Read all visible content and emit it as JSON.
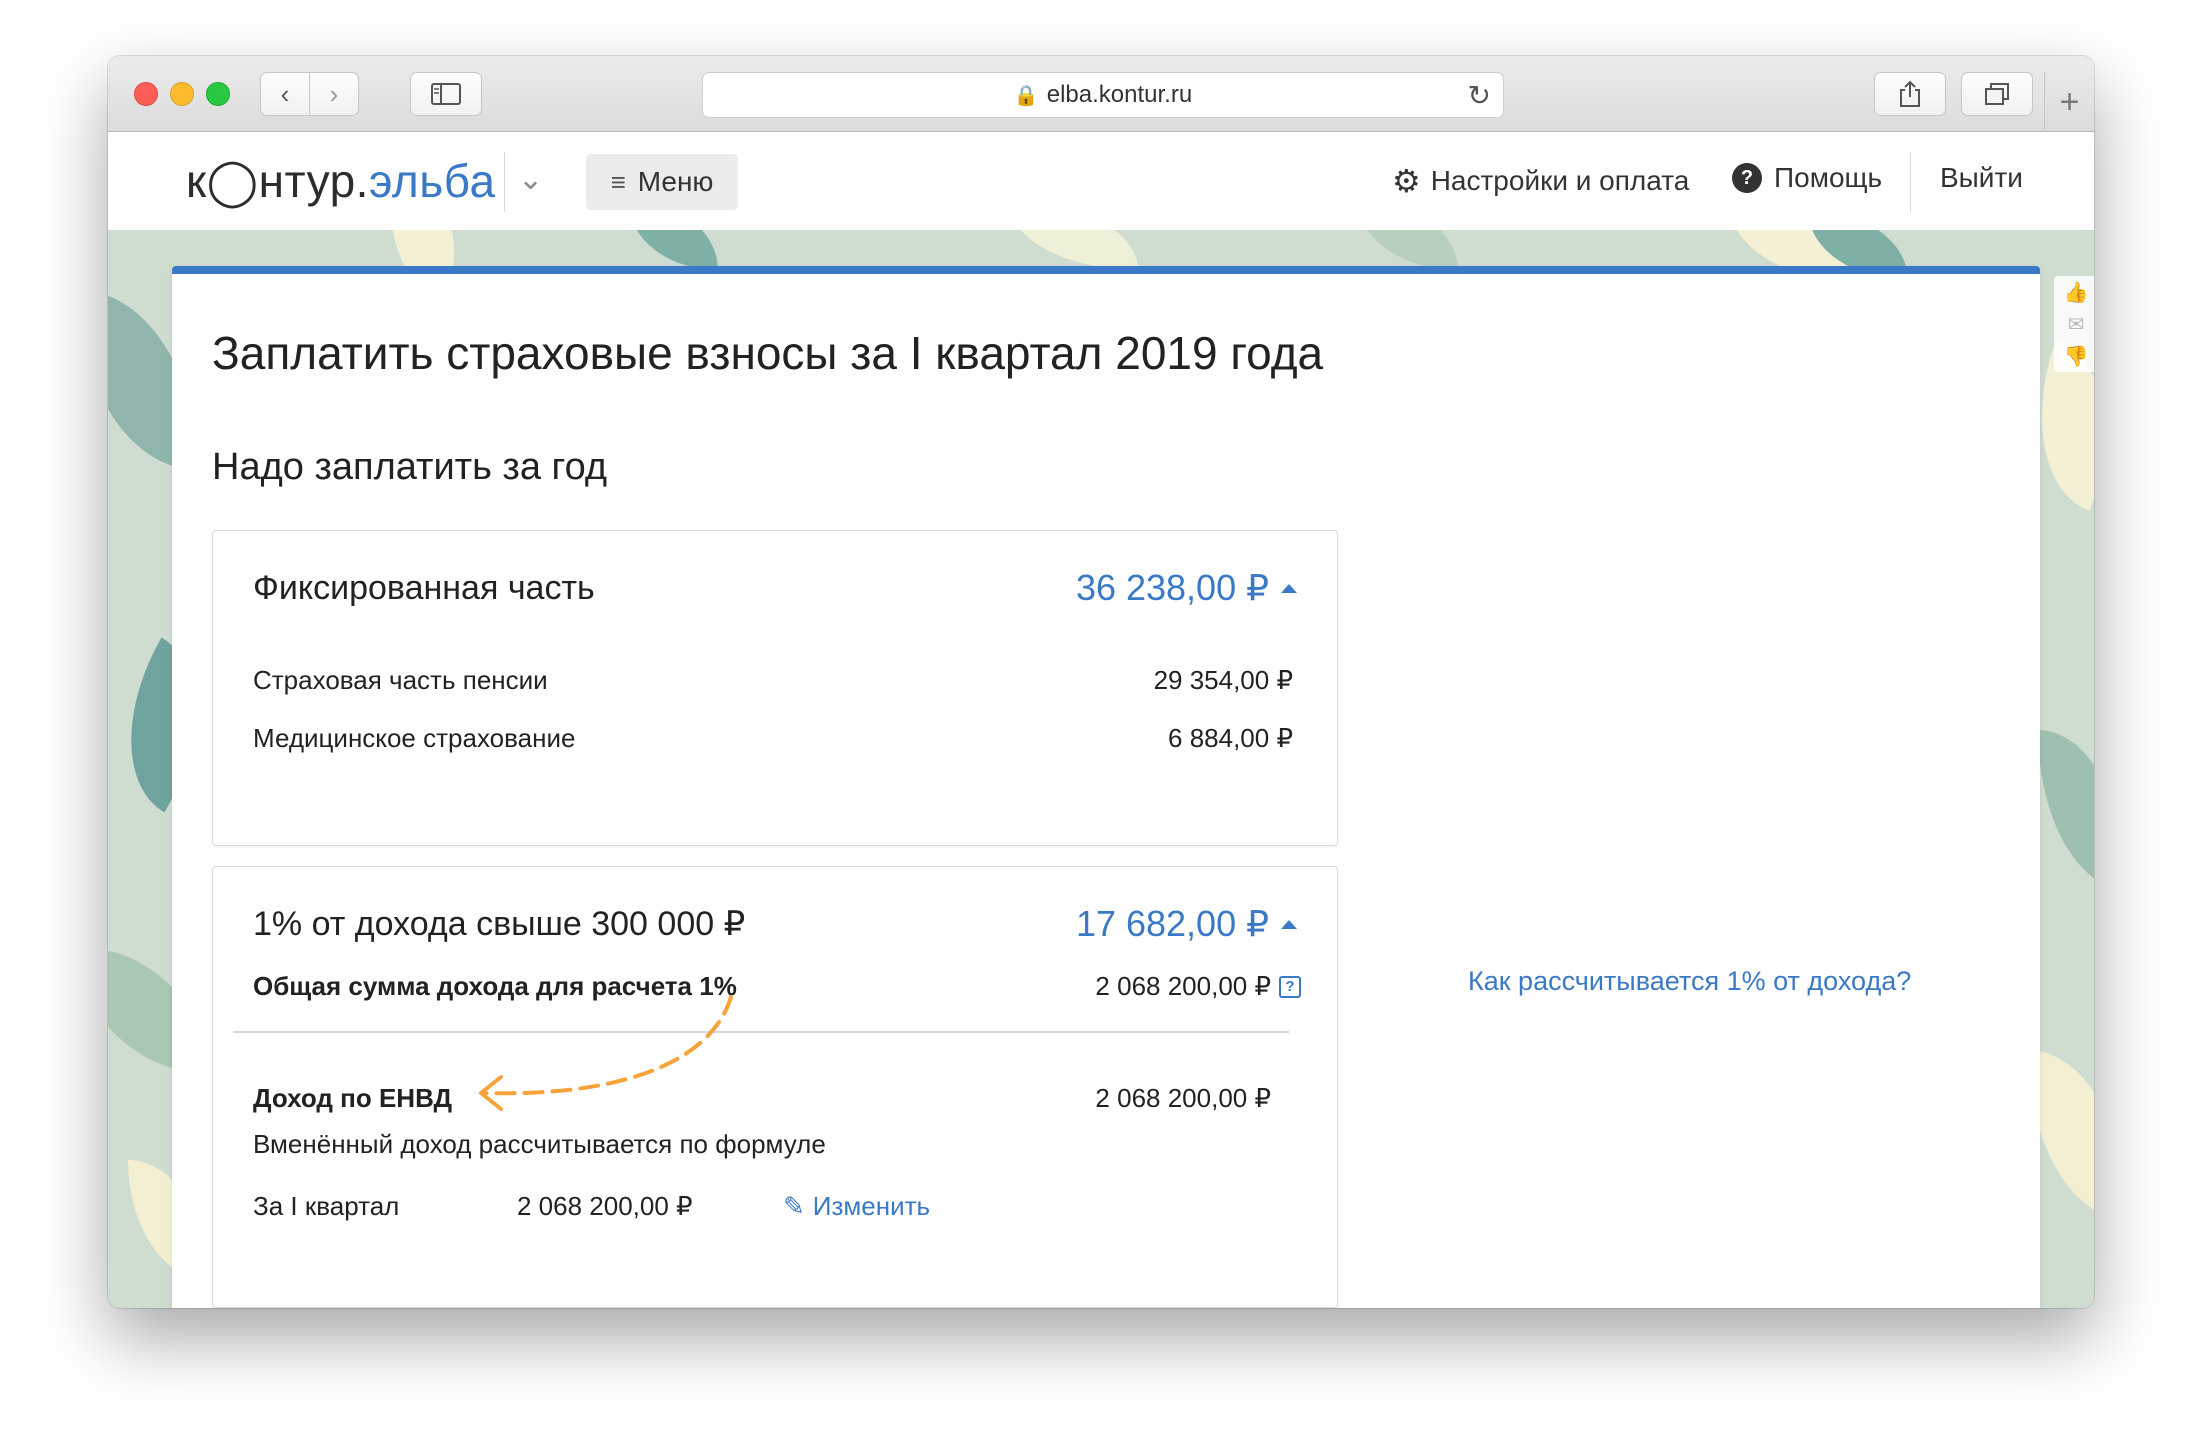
{
  "browser": {
    "url": "elba.kontur.ru"
  },
  "header": {
    "logo_main": "к◯нтур.",
    "logo_accent": "эльба",
    "menu_label": "Меню",
    "settings_label": "Настройки и оплата",
    "help_label": "Помощь",
    "logout_label": "Выйти"
  },
  "page": {
    "title": "Заплатить страховые взносы за I квартал 2019 года",
    "section_title": "Надо заплатить за год",
    "fixed": {
      "label": "Фиксированная часть",
      "amount": "36 238,00 ₽",
      "rows": [
        {
          "label": "Страховая часть пенсии",
          "value": "29 354,00 ₽"
        },
        {
          "label": "Медицинское страхование",
          "value": "6 884,00 ₽"
        }
      ]
    },
    "percent": {
      "label": "1% от дохода свыше 300 000 ₽",
      "amount": "17 682,00 ₽",
      "total_label": "Общая сумма дохода для расчета 1%",
      "total_value": "2 068 200,00 ₽",
      "envd_label": "Доход по ЕНВД",
      "envd_value": "2 068 200,00 ₽",
      "formula_note": "Вменённый доход рассчитывается по формуле",
      "quarter_label": "За I квартал",
      "quarter_value": "2 068 200,00 ₽",
      "edit_label": "Изменить"
    },
    "side_link": "Как рассчитывается 1% от дохода?"
  },
  "colors": {
    "accent": "#3a79c6",
    "annotation_arrow": "#f5a33a"
  }
}
